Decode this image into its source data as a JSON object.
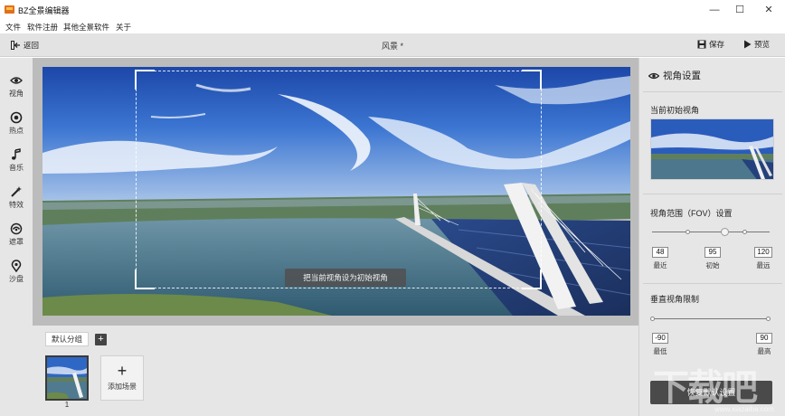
{
  "window": {
    "title": "BZ全景编辑器",
    "minimize_glyph": "—",
    "maximize_glyph": "☐",
    "close_glyph": "✕"
  },
  "menu": [
    {
      "label": "文件"
    },
    {
      "label": "软件注册"
    },
    {
      "label": "其他全景软件"
    },
    {
      "label": "关于"
    }
  ],
  "toolbar": {
    "back_label": "返回",
    "scene_title": "风景 *",
    "save_label": "保存",
    "preview_label": "预览"
  },
  "sidebar": {
    "items": [
      {
        "label": "视角",
        "icon": "eye-icon"
      },
      {
        "label": "热点",
        "icon": "hotspot-icon"
      },
      {
        "label": "音乐",
        "icon": "music-icon"
      },
      {
        "label": "特效",
        "icon": "effects-icon"
      },
      {
        "label": "遮罩",
        "icon": "mask-icon"
      },
      {
        "label": "沙盘",
        "icon": "sandbox-icon"
      }
    ]
  },
  "canvas": {
    "set_initial_button": "把当前视角设为初始视角"
  },
  "scenes": {
    "group_label": "默认分组",
    "add_group_glyph": "+",
    "items": [
      {
        "number": "1"
      }
    ],
    "add_scene_glyph": "+",
    "add_scene_label": "添加场景"
  },
  "panel": {
    "title": "视角设置",
    "initial_view_label": "当前初始视角",
    "fov_label": "视角范围（FOV）设置",
    "fov": {
      "min": "48",
      "initial": "95",
      "max": "120",
      "min_label": "最近",
      "initial_label": "初始",
      "max_label": "最远"
    },
    "vertical_label": "垂直视角限制",
    "vertical": {
      "min": "-90",
      "max": "90",
      "min_label": "最低",
      "max_label": "最高"
    },
    "reset_button": "恢复默认设置"
  },
  "watermark": {
    "text": "下载吧",
    "url": "www.xiazaiba.com"
  },
  "colors": {
    "sky_top": "#1f4fb0",
    "sky_mid": "#3f7ad6",
    "water": "#4f7a8f",
    "panel_bg": "#e6e6e6",
    "canvas_bg": "#bcbcbc",
    "dark_button": "#4a4a4a"
  }
}
